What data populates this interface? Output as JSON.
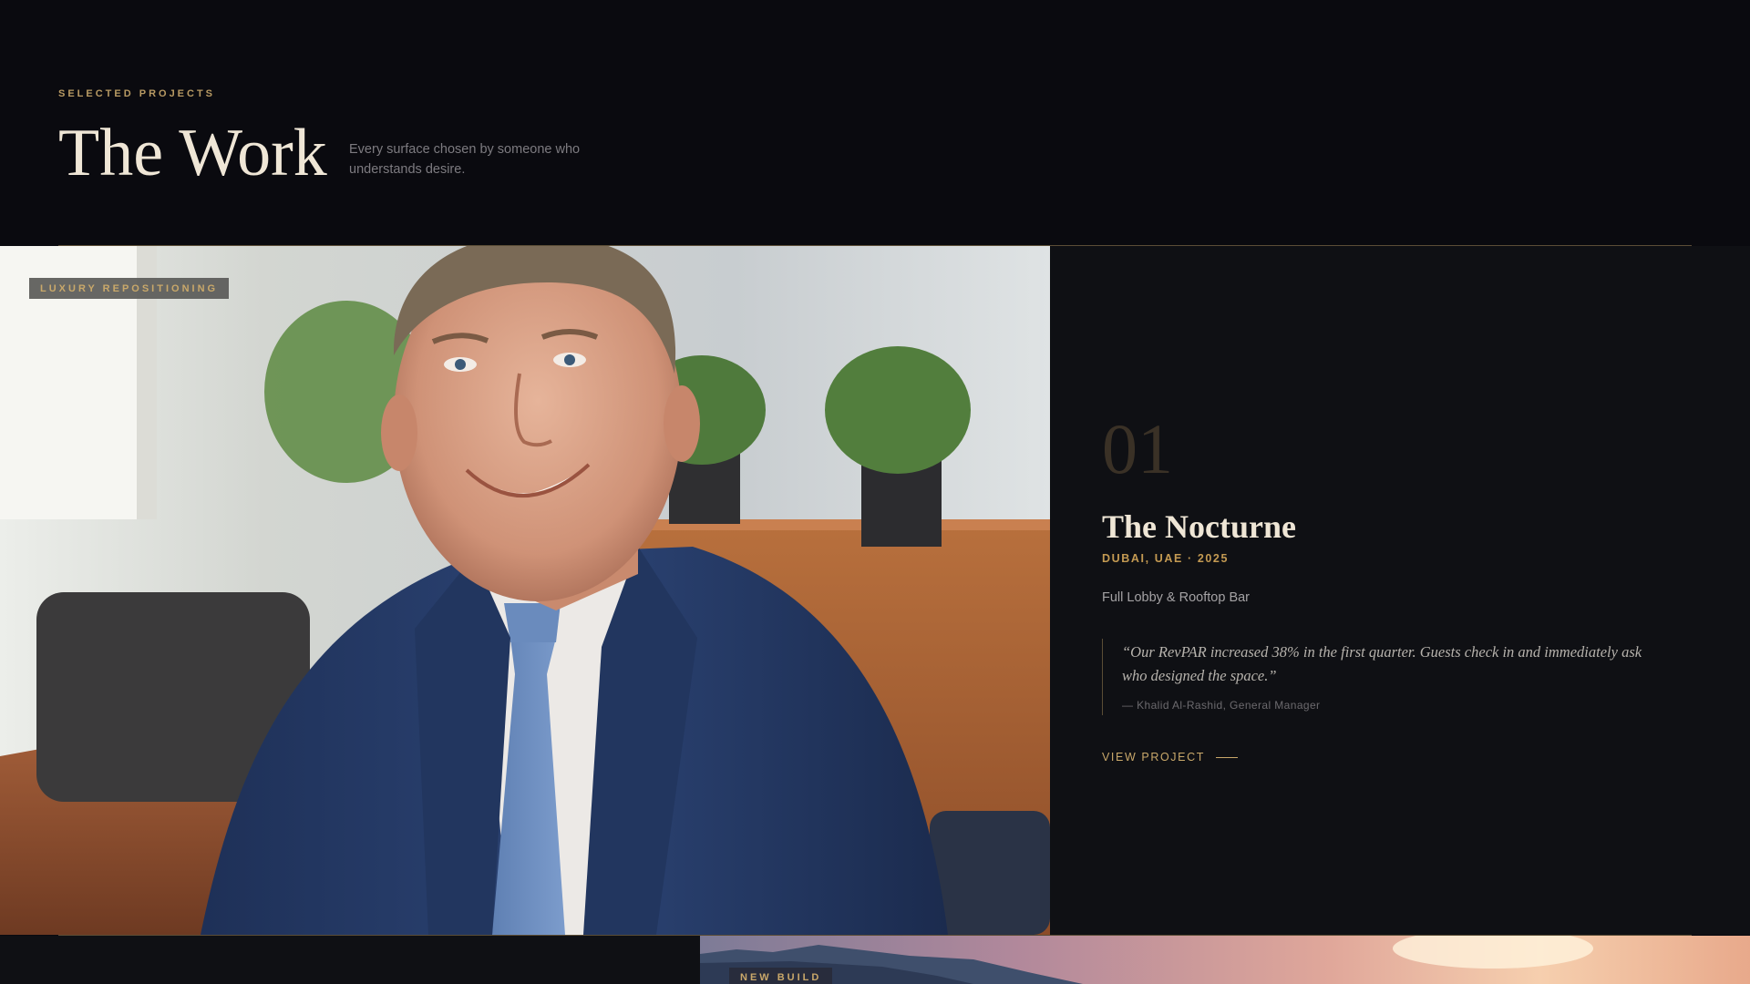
{
  "header": {
    "eyebrow": "SELECTED PROJECTS",
    "title": "The Work",
    "subtitle": "Every surface chosen by someone who understands desire."
  },
  "project": {
    "tag": "LUXURY REPOSITIONING",
    "number": "01",
    "title": "The Nocturne",
    "location": "DUBAI, UAE · 2025",
    "scope": "Full Lobby & Rooftop Bar",
    "quote": "“Our RevPAR increased 38% in the first quarter. Guests check in and immediately ask who designed the space.”",
    "attribution": "— Khalid Al-Rashid, General Manager",
    "cta": "VIEW PROJECT"
  },
  "next_project": {
    "tag": "NEW BUILD"
  },
  "colors": {
    "background": "#0a0a0f",
    "accent_gold": "#c9a86a",
    "card_bg": "#0f1014"
  }
}
